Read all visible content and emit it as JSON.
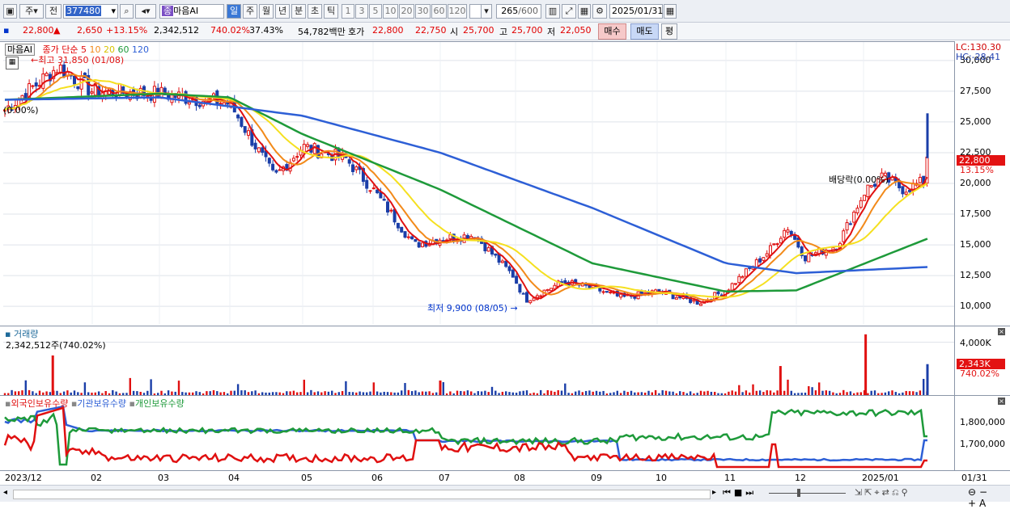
{
  "toolbar": {
    "market": "주",
    "prev_label": "전",
    "code": "377480",
    "stock_name": "마음AI",
    "stock_badge": "종",
    "periods": [
      "일",
      "주",
      "월",
      "년",
      "분",
      "초",
      "틱"
    ],
    "active_period": "일",
    "intervals": [
      "1",
      "3",
      "5",
      "10",
      "20",
      "30",
      "60",
      "120"
    ],
    "count": "265",
    "count_total": "/600",
    "date": "2025/01/31"
  },
  "quote": {
    "price": "22,800",
    "arrow": "▲",
    "change": "2,650",
    "change_pct": "+13.15%",
    "volume": "2,342,512",
    "vol_ratio": "740.02%",
    "turnover": "37.43%",
    "amount": "54,782백만",
    "bid_label": "호가",
    "ask": "22,800",
    "bid": "22,750",
    "open_label": "시",
    "open": "25,700",
    "high_label": "고",
    "high": "25,700",
    "low_label": "저",
    "low": "22,050",
    "buy_label": "매수",
    "sell_label": "매도",
    "avg_label": "평"
  },
  "price_pane": {
    "legend_name": "마음AI",
    "legend_ma": "종가 단순",
    "ma_periods": [
      "5",
      "10",
      "20",
      "60",
      "120"
    ],
    "ma_colors": [
      "#e01010",
      "#f28a1a",
      "#f5e020",
      "#1e9a3a",
      "#2d5fd6"
    ],
    "lc": "LC:130.30",
    "hc": "HC:-28.41",
    "high_annot": "최고 31,850 (01/08)",
    "low_annot": "최저 9,900 (08/05)",
    "div_annot": "배당락(0.00%)",
    "div_annot_left": "(0.00%)",
    "price_tag": "22,800",
    "pct_tag": "13.15%"
  },
  "volume_pane": {
    "title": "거래량",
    "value": "2,342,512주(740.02%)",
    "tag": "2,343K",
    "tag_pct": "740.02%",
    "ytick": "4,000K"
  },
  "holding_pane": {
    "legend": [
      "외국인보유수량",
      "기관보유수량",
      "개인보유수량"
    ],
    "legend_colors": [
      "#e01010",
      "#2d5fd6",
      "#1e9a3a"
    ],
    "yticks": [
      "1,800,000",
      "1,700,000"
    ]
  },
  "x_axis": [
    "2023/12",
    "02",
    "03",
    "04",
    "05",
    "06",
    "07",
    "08",
    "09",
    "10",
    "11",
    "12",
    "2025/01"
  ],
  "x_axis_end": "01/31",
  "chart_data": {
    "type": "candlestick",
    "ylim": [
      8500,
      31500
    ],
    "yticks": [
      10000,
      12500,
      15000,
      17500,
      20000,
      22500,
      25000,
      27500,
      30000
    ],
    "price_keypoints": [
      [
        "2023/12",
        26000
      ],
      [
        "2024/01/08",
        29500
      ],
      [
        "2024/02",
        27500
      ],
      [
        "2024/03",
        27300
      ],
      [
        "2024/04",
        26500
      ],
      [
        "2024/04/20",
        20500
      ],
      [
        "2024/05",
        23000
      ],
      [
        "2024/05/20",
        22000
      ],
      [
        "2024/06",
        19500
      ],
      [
        "2024/06/20",
        15000
      ],
      [
        "2024/07",
        15500
      ],
      [
        "2024/07/15",
        15800
      ],
      [
        "2024/07/31",
        12500
      ],
      [
        "2024/08/05",
        10500
      ],
      [
        "2024/08/20",
        12000
      ],
      [
        "2024/09",
        11500
      ],
      [
        "2024/09/15",
        10700
      ],
      [
        "2024/10",
        11200
      ],
      [
        "2024/10/20",
        10300
      ],
      [
        "2024/11",
        11300
      ],
      [
        "2024/11/20",
        14500
      ],
      [
        "2024/11/28",
        16500
      ],
      [
        "2024/12/05",
        14000
      ],
      [
        "2024/12/20",
        15000
      ],
      [
        "2025/01/02",
        19500
      ],
      [
        "2025/01/10",
        20500
      ],
      [
        "2025/01/20",
        19500
      ],
      [
        "2025/01/30",
        20200
      ],
      [
        "2025/01/31",
        22800
      ]
    ],
    "ma120_keypoints": [
      [
        "2023/12",
        26800
      ],
      [
        "2024/03",
        27000
      ],
      [
        "2024/05",
        25500
      ],
      [
        "2024/07",
        22500
      ],
      [
        "2024/09",
        18000
      ],
      [
        "2024/11",
        13500
      ],
      [
        "2024/12",
        12700
      ],
      [
        "2025/01/31",
        13200
      ]
    ],
    "ma60_keypoints": [
      [
        "2023/12",
        26800
      ],
      [
        "2024/03",
        27300
      ],
      [
        "2024/04",
        27000
      ],
      [
        "2024/05",
        24000
      ],
      [
        "2024/07",
        19500
      ],
      [
        "2024/09",
        13500
      ],
      [
        "2024/11",
        11200
      ],
      [
        "2024/12",
        11300
      ],
      [
        "2025/01/31",
        15500
      ]
    ],
    "volume_keypoints": [
      [
        "2024/01/04",
        3000
      ],
      [
        "2024/07/01",
        1100
      ],
      [
        "2024/11/25",
        2200
      ],
      [
        "2025/01/02",
        4600
      ],
      [
        "2025/01/31",
        2343
      ]
    ],
    "volume_ylim": [
      0,
      5200
    ],
    "volume_ytick": 4000
  }
}
